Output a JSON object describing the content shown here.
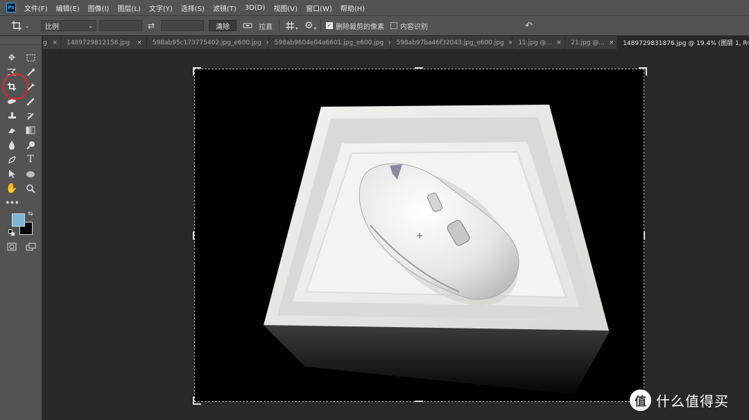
{
  "app": {
    "logo": "Ps"
  },
  "menu": [
    "文件(F)",
    "编辑(E)",
    "图像(I)",
    "图层(L)",
    "文字(Y)",
    "选择(S)",
    "滤镜(T)",
    "3D(D)",
    "视图(V)",
    "窗口(W)",
    "帮助(H)"
  ],
  "options": {
    "ratio_select": "比例",
    "swap_glyph": "⇄",
    "clear_button": "清除",
    "straighten_label": "拉直",
    "delete_cropped_label": "删除裁剪的像素",
    "delete_cropped_checked": true,
    "content_aware_label": "内容识别",
    "content_aware_checked": false
  },
  "tabs": [
    {
      "label": "g",
      "active": false
    },
    {
      "label": "1489729812158.jpg",
      "active": false
    },
    {
      "label": "598ab95c173775402.jpg_e600.jpg",
      "active": false
    },
    {
      "label": "598ab9604e04a6601.jpg_e600.jpg",
      "active": false
    },
    {
      "label": "598ab97ba46f32043.jpg_e600.jpg",
      "active": false
    },
    {
      "label": "11.jpg @...",
      "active": false
    },
    {
      "label": "21.jpg @...",
      "active": false
    },
    {
      "label": "1489729831876.jpg @ 19.4% (图层 1, RG",
      "active": true
    }
  ],
  "tools": [
    "move-tool",
    "marquee-tool",
    "lasso-tool",
    "quick-selection-tool",
    "crop-tool",
    "eyedropper-tool",
    "healing-brush-tool",
    "brush-tool",
    "clone-stamp-tool",
    "history-brush-tool",
    "eraser-tool",
    "gradient-tool",
    "blur-tool",
    "dodge-tool",
    "pen-tool",
    "type-tool",
    "path-selection-tool",
    "ellipse-tool",
    "hand-tool",
    "zoom-tool",
    "more-tools"
  ],
  "colors": {
    "foreground": "#7ab7d9",
    "background": "#000000"
  },
  "watermark": {
    "icon": "值",
    "text": "什么值得买"
  }
}
